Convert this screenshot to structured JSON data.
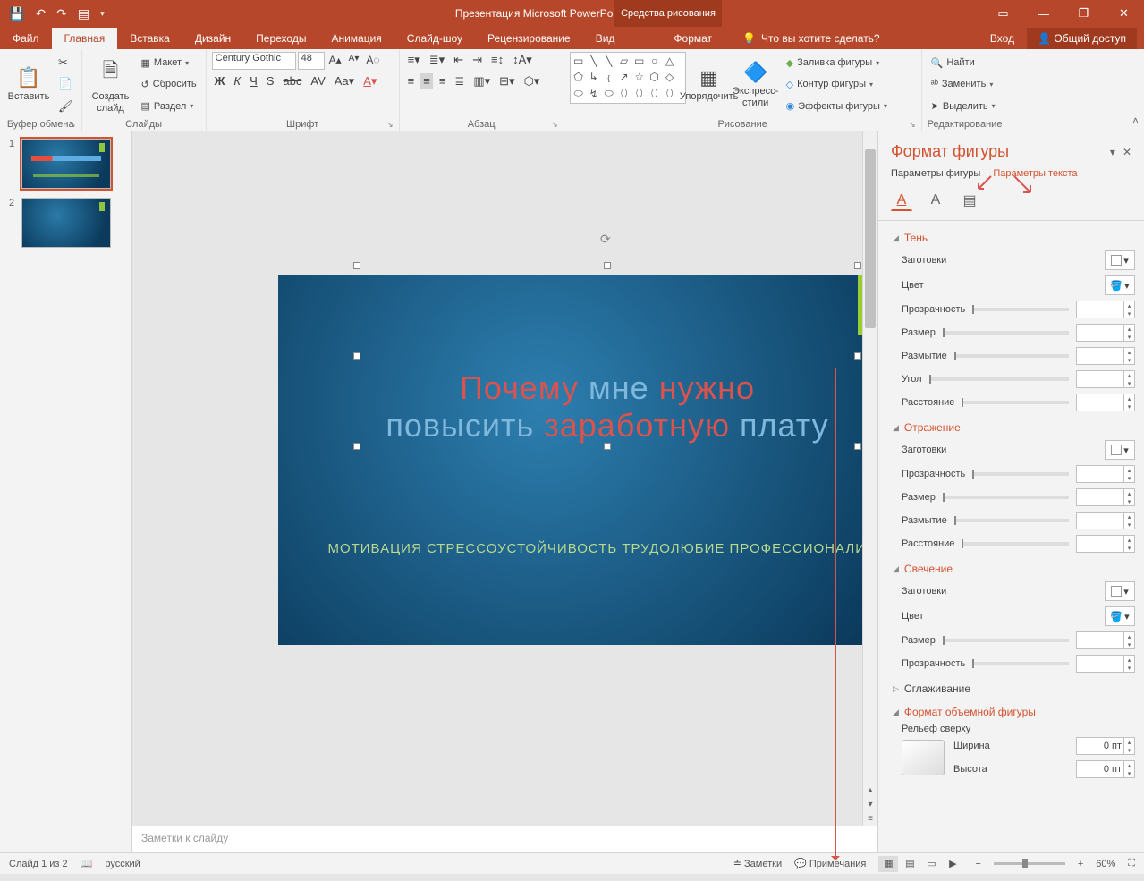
{
  "titlebar": {
    "title": "Презентация Microsoft PowerPoint - PowerPoint",
    "context_tab": "Средства рисования"
  },
  "tabs": {
    "file": "Файл",
    "home": "Главная",
    "insert": "Вставка",
    "design": "Дизайн",
    "transitions": "Переходы",
    "animation": "Анимация",
    "slideshow": "Слайд-шоу",
    "review": "Рецензирование",
    "view": "Вид",
    "format": "Формат",
    "tellme": "Что вы хотите сделать?",
    "signin": "Вход",
    "share": "Общий доступ"
  },
  "ribbon": {
    "clipboard": {
      "label": "Буфер обмена",
      "paste": "Вставить"
    },
    "slides": {
      "label": "Слайды",
      "new": "Создать слайд",
      "layout": "Макет",
      "reset": "Сбросить",
      "section": "Раздел"
    },
    "font": {
      "label": "Шрифт",
      "name": "Century Gothic",
      "size": "48"
    },
    "paragraph": {
      "label": "Абзац"
    },
    "drawing": {
      "label": "Рисование",
      "arrange": "Упорядочить",
      "quick": "Экспресс-стили",
      "fill": "Заливка фигуры",
      "outline": "Контур фигуры",
      "effects": "Эффекты фигуры"
    },
    "editing": {
      "label": "Редактирование",
      "find": "Найти",
      "replace": "Заменить",
      "select": "Выделить"
    }
  },
  "slide": {
    "title_w1": "Почему",
    "title_w2": "мне",
    "title_w3": "нужно",
    "title_w4": "повысить",
    "title_w5": "заработную",
    "title_w6": "плату",
    "subtitle": "МОТИВАЦИЯ СТРЕССОУСТОЙЧИВОСТЬ ТРУДОЛЮБИЕ ПРОФЕССИОНАЛИЗМ"
  },
  "notes_placeholder": "Заметки к слайду",
  "fmt": {
    "title": "Формат фигуры",
    "tab_shape": "Параметры фигуры",
    "tab_text": "Параметры текста",
    "shadow": "Тень",
    "reflection": "Отражение",
    "glow": "Свечение",
    "soft": "Сглаживание",
    "threeD": "Формат объемной фигуры",
    "presets": "Заготовки",
    "color": "Цвет",
    "transparency": "Прозрачность",
    "size": "Размер",
    "blur": "Размытие",
    "angle": "Угол",
    "distance": "Расстояние",
    "bevel_top": "Рельеф сверху",
    "width": "Ширина",
    "height": "Высота",
    "zero_pt": "0 пт"
  },
  "status": {
    "slide": "Слайд 1 из 2",
    "lang": "русский",
    "notes": "Заметки",
    "comments": "Примечания",
    "zoom": "60%"
  }
}
